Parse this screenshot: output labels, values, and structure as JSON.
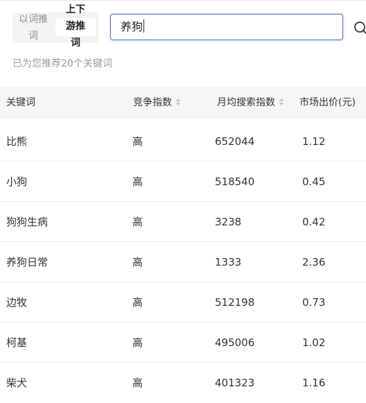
{
  "toggle": {
    "option_left": "以词推词",
    "option_right": "上下游推词"
  },
  "search": {
    "value": "养狗",
    "icon": "search-icon"
  },
  "hint": "已为您推荐20个关键词",
  "table": {
    "columns": [
      "关键词",
      "竞争指数",
      "月均搜索指数",
      "市场出价(元)"
    ],
    "rows": [
      {
        "keyword": "比熊",
        "competition": "高",
        "search_index": "652044",
        "price": "1.12"
      },
      {
        "keyword": "小狗",
        "competition": "高",
        "search_index": "518540",
        "price": "0.45"
      },
      {
        "keyword": "狗狗生病",
        "competition": "高",
        "search_index": "3238",
        "price": "0.42"
      },
      {
        "keyword": "养狗日常",
        "competition": "高",
        "search_index": "1333",
        "price": "2.36"
      },
      {
        "keyword": "边牧",
        "competition": "高",
        "search_index": "512198",
        "price": "0.73"
      },
      {
        "keyword": "柯基",
        "competition": "高",
        "search_index": "495006",
        "price": "1.02"
      },
      {
        "keyword": "柴犬",
        "competition": "高",
        "search_index": "401323",
        "price": "1.16"
      }
    ]
  },
  "colors": {
    "accent": "#4f6fcf",
    "header_bg": "#f5f6f8",
    "hint_text": "#9a9a9a"
  }
}
